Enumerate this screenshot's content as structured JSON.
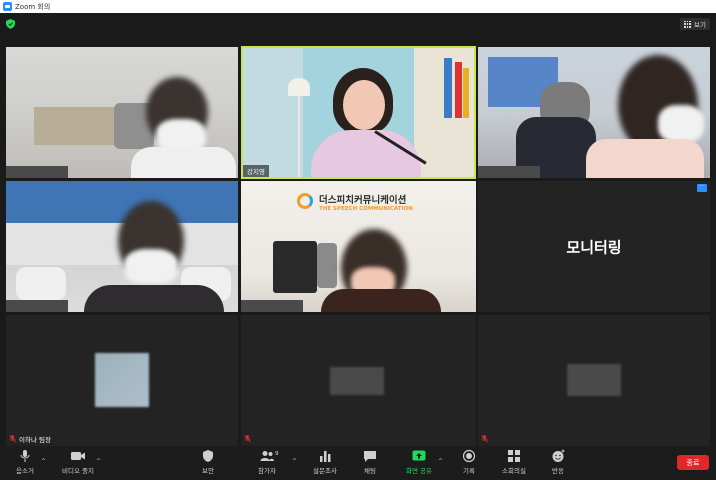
{
  "window": {
    "title": "Zoom 회의"
  },
  "header": {
    "view_label": "보기"
  },
  "participants": {
    "host_name": "강지영",
    "lee_name": "이하나 팀장"
  },
  "monitor_tile": {
    "label": "모니터링"
  },
  "company_banner": {
    "korean": "더스피치커뮤니케이션",
    "english": "THE SPEECH COMMUNICATION"
  },
  "toolbar": {
    "audio": "음소거",
    "video": "비디오 중지",
    "security": "보안",
    "participants": "참가자",
    "participant_count": "9",
    "polls": "설문조사",
    "chat": "채팅",
    "share": "화면 공유",
    "record": "기록",
    "breakout": "소회의실",
    "reactions": "반응",
    "end": "종료"
  },
  "colors": {
    "share_green": "#23d959",
    "end_red": "#e02828",
    "active_speaker": "#c8e84a",
    "zoom_blue": "#2d8cff"
  }
}
